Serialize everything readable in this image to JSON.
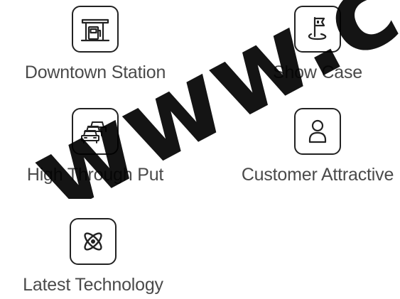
{
  "watermark": {
    "text": "www.c"
  },
  "features": {
    "downtown": {
      "label": "Downtown Station",
      "icon": "gas-station-icon"
    },
    "showcase": {
      "label": "Show Case",
      "icon": "flag-pin-icon"
    },
    "throughput": {
      "label": "High Through Put",
      "icon": "cars-icon"
    },
    "customer": {
      "label": "Customer Attractive",
      "icon": "person-icon"
    },
    "technology": {
      "label": "Latest Technology",
      "icon": "atom-icon"
    }
  },
  "colors": {
    "icon_stroke": "#222222",
    "label_text": "#4a4a4a",
    "background": "#ffffff"
  }
}
